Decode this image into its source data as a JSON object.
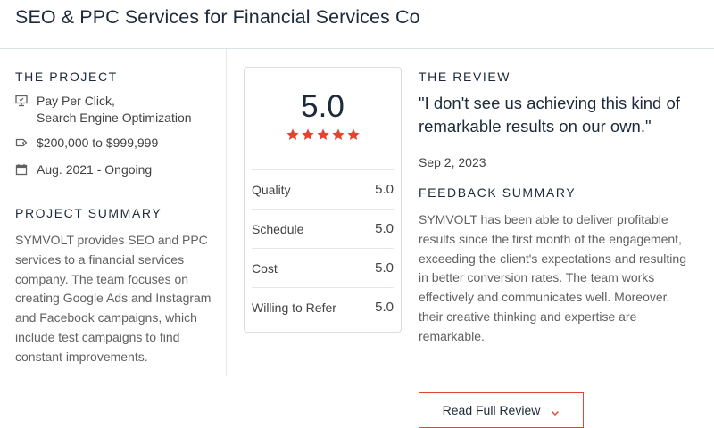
{
  "header": {
    "title": "SEO & PPC Services for Financial Services Co"
  },
  "project": {
    "label": "THE PROJECT",
    "services_line1": "Pay Per Click,",
    "services_line2": "Search Engine Optimization",
    "budget": "$200,000 to $999,999",
    "dates": "Aug. 2021 - Ongoing",
    "icons": {
      "services": "desktop-icon",
      "budget": "tag-icon",
      "dates": "calendar-icon"
    }
  },
  "summary": {
    "label": "PROJECT SUMMARY",
    "text": "SYMVOLT provides SEO and PPC services to a financial services company. The team focuses on creating Google Ads and Instagram and Facebook campaigns, which include test campaigns to find constant improvements."
  },
  "ratings": {
    "overall": "5.0",
    "stars": 5,
    "star_color": "#e5422f",
    "rows": [
      {
        "label": "Quality",
        "value": "5.0"
      },
      {
        "label": "Schedule",
        "value": "5.0"
      },
      {
        "label": "Cost",
        "value": "5.0"
      },
      {
        "label": "Willing to Refer",
        "value": "5.0"
      }
    ]
  },
  "review": {
    "label": "THE REVIEW",
    "quote": "\"I don't see us achieving this kind of remarkable results on our own.\"",
    "date": "Sep 2, 2023",
    "feedback_label": "FEEDBACK SUMMARY",
    "feedback_text": "SYMVOLT has been able to deliver profitable results since the first month of the engagement, exceeding the client's expectations and resulting in better conversion rates. The team works effectively and communicates well. Moreover, their creative thinking and expertise are remarkable."
  },
  "actions": {
    "read_full_review": "Read Full Review",
    "accent": "#e5422f"
  }
}
